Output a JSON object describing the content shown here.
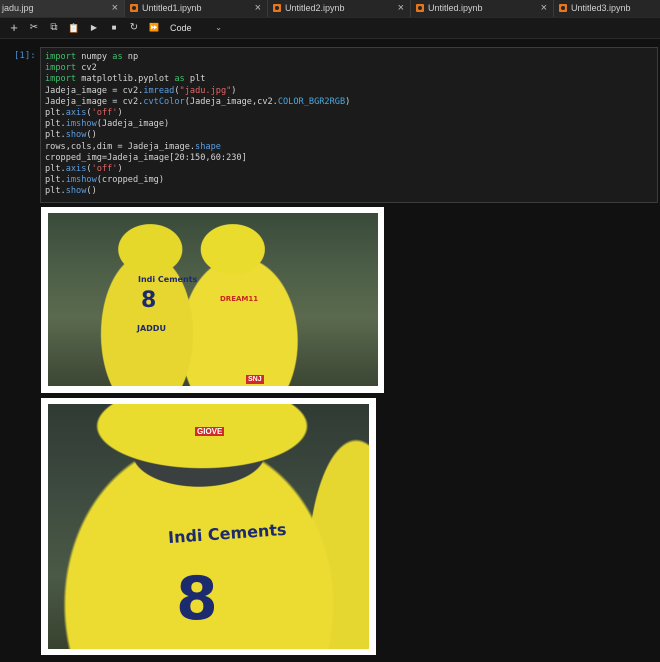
{
  "tabs": [
    {
      "label": "jadu.jpg",
      "close": "×",
      "active": true
    },
    {
      "label": "Untitled1.ipynb",
      "close": "×",
      "active": false
    },
    {
      "label": "Untitled2.ipynb",
      "close": "×",
      "active": false
    },
    {
      "label": "Untitled.ipynb",
      "close": "×",
      "active": false
    },
    {
      "label": "Untitled3.ipynb",
      "close": "",
      "active": false
    }
  ],
  "toolbar": {
    "add": "+",
    "cut": "✂",
    "copy": "⧉",
    "paste": "📋",
    "run": "▶",
    "stop": "■",
    "restart": "↻",
    "run_all": "⏩",
    "cell_type": "Code",
    "cell_type_chevron": "⌄"
  },
  "cell": {
    "prompt": "[1]:",
    "code": [
      "import numpy as np",
      "import cv2",
      "import matplotlib.pyplot as plt",
      "Jadeja_image = cv2.imread(\"jadu.jpg\")",
      "Jadeja_image = cv2.cvtColor(Jadeja_image,cv2.COLOR_BGR2RGB)",
      "plt.axis('off')",
      "plt.imshow(Jadeja_image)",
      "plt.show()",
      "rows,cols,dim = Jadeja_image.shape",
      "cropped_img=Jadeja_image[20:150,60:230]",
      "plt.axis('off')",
      "plt.imshow(cropped_img)",
      "plt.show()"
    ]
  },
  "outputs": {
    "img1": {
      "jersey_name": "JADDU",
      "jersey_number": "8",
      "sponsor": "Indi Cements",
      "right_player_text": "SNJ",
      "logo": "DREAM11"
    },
    "img2": {
      "jersey_number": "8",
      "sponsor": "Indi Cements",
      "helmet_logo": "GIOVE"
    }
  },
  "colors": {
    "accent": "#e8761a",
    "prompt": "#4a8fd6",
    "keyword": "#3fbf6c",
    "string": "#e06464"
  }
}
